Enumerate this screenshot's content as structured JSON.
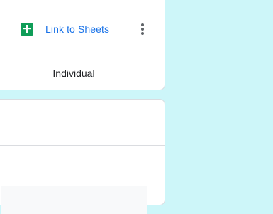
{
  "header": {
    "link_label": "Link to Sheets",
    "link_icon": "google-sheets-icon",
    "more_icon": "more-vert-icon"
  },
  "tabs": {
    "active_label": "Individual"
  },
  "colors": {
    "link": "#1a73e8",
    "sheets_green": "#0f9d58",
    "background": "#cdf6f9"
  }
}
